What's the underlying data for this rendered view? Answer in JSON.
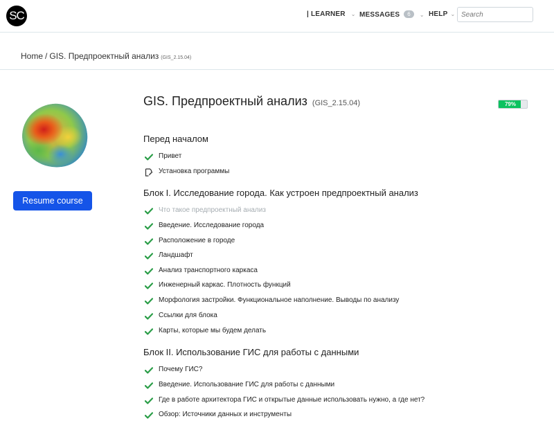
{
  "header": {
    "logo": "SC",
    "nav": [
      {
        "label": "| LEARNER"
      },
      {
        "label": "MESSAGES",
        "badge": "6"
      },
      {
        "label": "HELP"
      }
    ],
    "search_placeholder": "Search"
  },
  "breadcrumb": {
    "home": "Home",
    "separator": "/",
    "current": "GIS. Предпроектный анализ",
    "code": "(GIS_2.15.04)"
  },
  "sidebar": {
    "resume_label": "Resume course"
  },
  "course": {
    "title": "GIS. Предпроектный анализ",
    "code": "(GIS_2.15.04)",
    "progress_label": "79%",
    "progress_value": 0.79,
    "progress_color": "#0bc25f"
  },
  "sections": [
    {
      "title": "Перед началом",
      "items": [
        {
          "label": "Привет",
          "icon": "check-icon"
        },
        {
          "label": "Установка программы",
          "icon": "document-edit-icon"
        }
      ]
    },
    {
      "title": "Блок I. Исследование города. Как устроен предпроектный анализ",
      "items": [
        {
          "label": "Что такое предпроектный анализ",
          "icon": "check-icon",
          "muted": true
        },
        {
          "label": "Введение. Исследование города",
          "icon": "check-icon"
        },
        {
          "label": "Расположение в городе",
          "icon": "check-icon"
        },
        {
          "label": "Ландшафт",
          "icon": "check-icon"
        },
        {
          "label": "Анализ транспортного каркаса",
          "icon": "check-icon"
        },
        {
          "label": "Инженерный каркас. Плотность функций",
          "icon": "check-icon"
        },
        {
          "label": "Морфология застройки. Функциональное наполнение. Выводы по анализу",
          "icon": "check-icon"
        },
        {
          "label": "Ссылки для блока",
          "icon": "check-icon"
        },
        {
          "label": "Карты, которые мы будем делать",
          "icon": "check-icon"
        }
      ]
    },
    {
      "title": "Блок II. Использование ГИС для работы с данными",
      "items": [
        {
          "label": "Почему ГИС?",
          "icon": "check-icon"
        },
        {
          "label": "Введение. Использование ГИС для работы с данными",
          "icon": "check-icon"
        },
        {
          "label": "Где в работе архитектора ГИС и открытые данные использовать нужно, а где нет?",
          "icon": "check-icon"
        },
        {
          "label": "Обзор: Источники данных и инструменты",
          "icon": "check-icon"
        }
      ]
    }
  ],
  "colors": {
    "accent": "#1554e8",
    "check": "#2a9d47",
    "muted_text": "#a6adb2"
  }
}
